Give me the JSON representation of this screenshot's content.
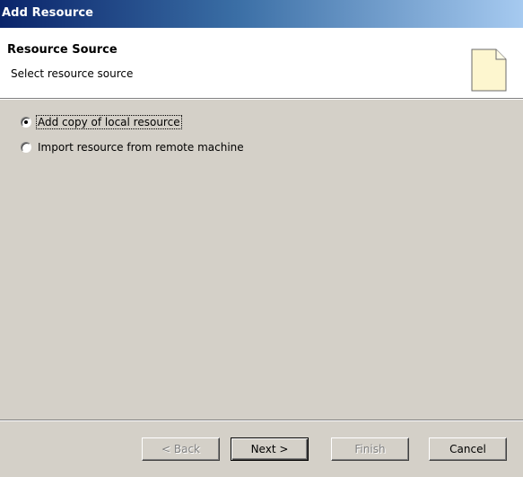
{
  "window": {
    "title": "Add Resource"
  },
  "header": {
    "title": "Resource Source",
    "description": "Select resource source",
    "icon": "page-icon"
  },
  "options": [
    {
      "label": "Add copy of local resource",
      "selected": true,
      "focused": true
    },
    {
      "label": "Import resource from remote machine",
      "selected": false,
      "focused": false
    }
  ],
  "buttons": {
    "back": {
      "label": "< Back",
      "enabled": false
    },
    "next": {
      "label": "Next >",
      "enabled": true,
      "default": true
    },
    "finish": {
      "label": "Finish",
      "enabled": false
    },
    "cancel": {
      "label": "Cancel",
      "enabled": true
    }
  }
}
